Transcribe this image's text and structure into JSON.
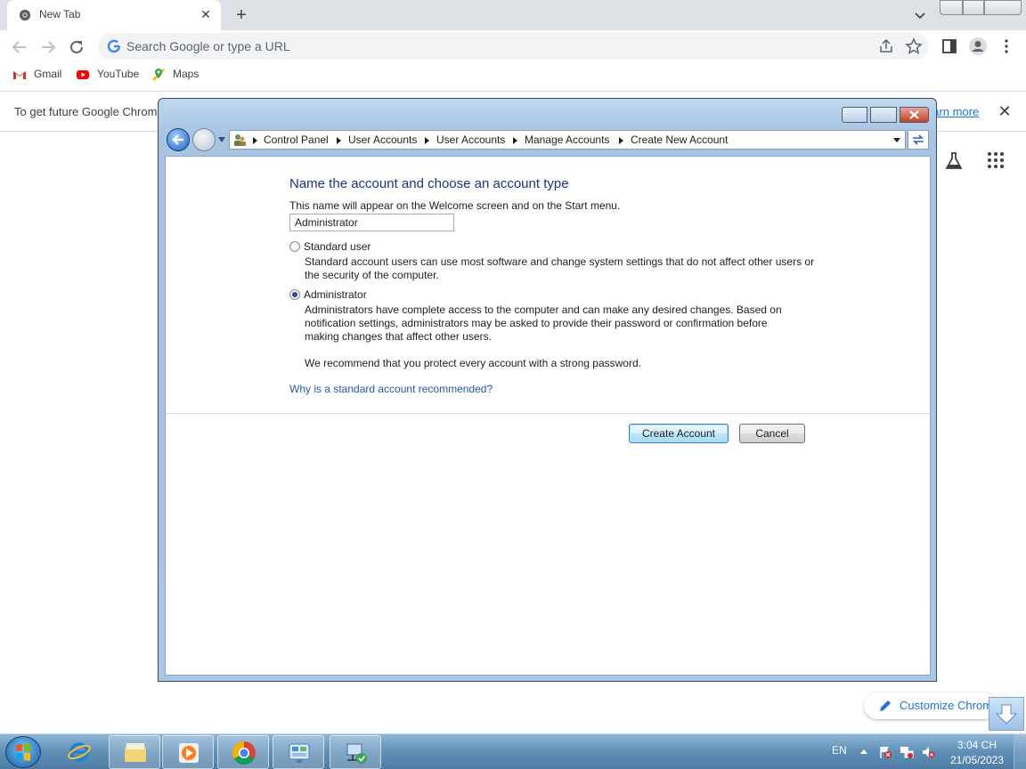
{
  "browser": {
    "tab_title": "New Tab",
    "omnibox_placeholder": "Search Google or type a URL",
    "bookmarks": [
      {
        "label": "Gmail",
        "icon": "gmail-icon"
      },
      {
        "label": "YouTube",
        "icon": "youtube-icon"
      },
      {
        "label": "Maps",
        "icon": "maps-icon"
      }
    ],
    "infobar_message": "To get future Google Chrom",
    "infobar_link": "earn more",
    "customize_label": "Customize Chrome"
  },
  "dialog": {
    "breadcrumbs": [
      "Control Panel",
      "User Accounts",
      "User Accounts",
      "Manage Accounts",
      "Create New Account"
    ],
    "heading": "Name the account and choose an account type",
    "name_hint": "This name will appear on the Welcome screen and on the Start menu.",
    "name_value": "Administrator",
    "options": [
      {
        "label": "Standard user",
        "selected": false,
        "desc_lines": [
          "Standard account users can use most software and change system settings that do not affect other users or",
          "the security of the computer."
        ]
      },
      {
        "label": "Administrator",
        "selected": true,
        "desc_lines": [
          "Administrators have complete access to the computer and can make any desired changes. Based on",
          "notification settings, administrators may be asked to provide their password or confirmation before",
          "making changes that affect other users."
        ]
      }
    ],
    "recommendation": "We recommend that you protect every account with a strong password.",
    "why_link": "Why is a standard account recommended?",
    "create_button": "Create Account",
    "cancel_button": "Cancel"
  },
  "taskbar": {
    "language": "EN",
    "time": "3:04 CH",
    "date": "21/05/2023",
    "pinned": [
      "internet-explorer-icon",
      "windows-explorer-icon",
      "media-player-icon",
      "chrome-icon",
      "control-panel-icon",
      "network-setup-icon"
    ]
  },
  "colors": {
    "chrome_tabstrip": "#dee1e6",
    "link_blue": "#1a73e8",
    "win7_heading": "#1e3287",
    "taskbar": "#5f8fb7"
  }
}
